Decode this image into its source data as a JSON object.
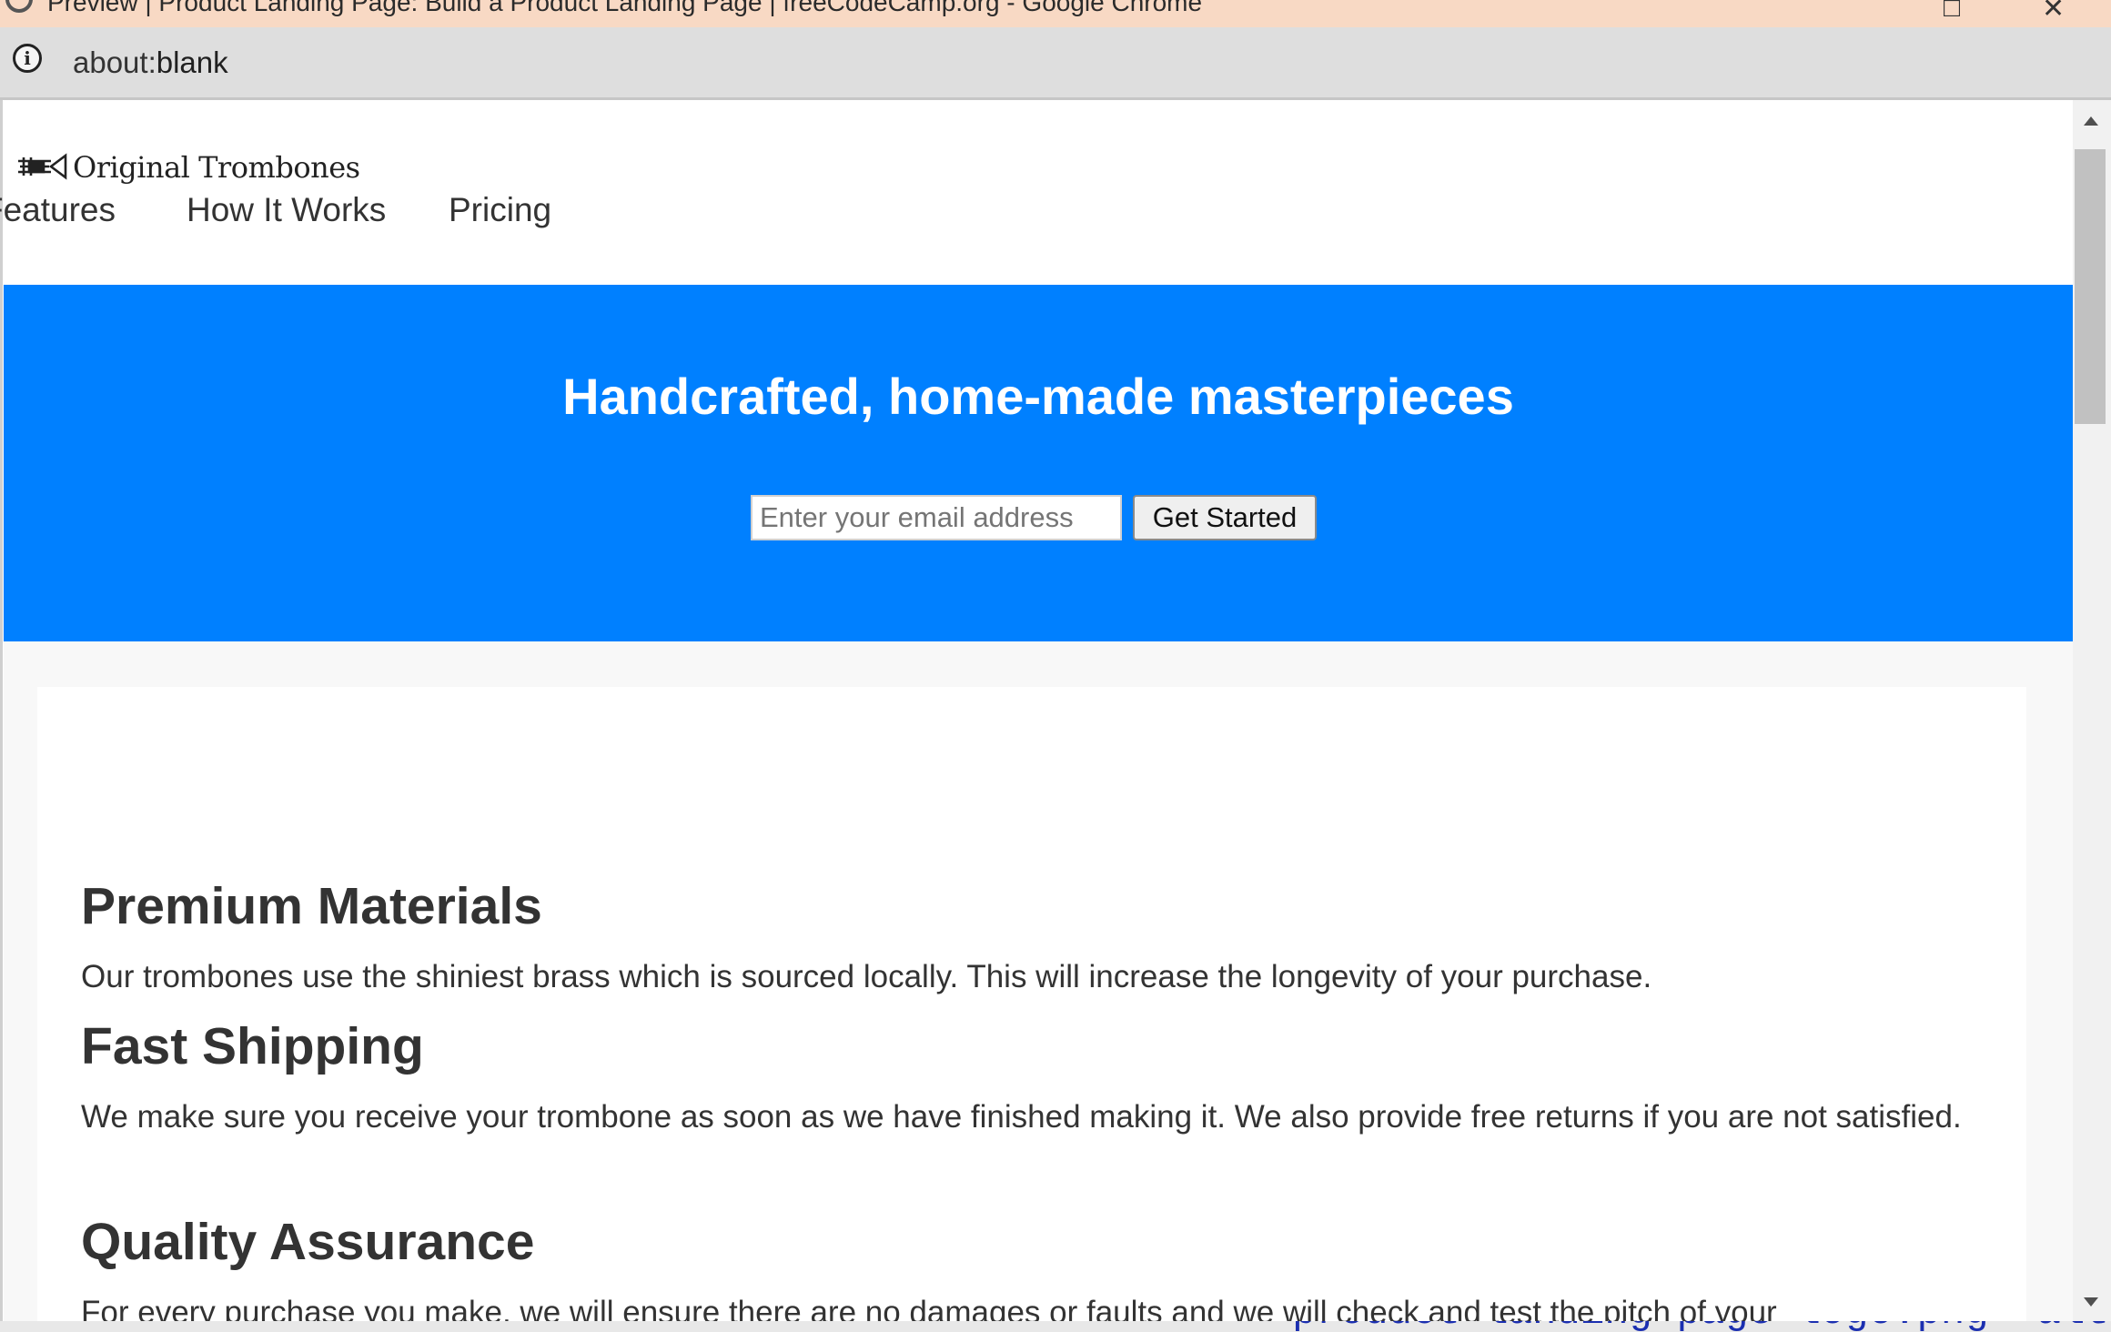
{
  "window": {
    "title": "Preview | Product Landing Page: Build a Product Landing Page | freeCodeCamp.org - Google Chrome",
    "maximize_glyph": "□",
    "close_glyph": "✕"
  },
  "address_bar": {
    "scheme": "about:",
    "host": "blank",
    "info_glyph": "i",
    "info_icon": "info-circle-icon"
  },
  "header": {
    "logo_icon": "trombone-icon",
    "brand": "Original Trombones",
    "nav": [
      {
        "label": "Features"
      },
      {
        "label": "How It Works"
      },
      {
        "label": "Pricing"
      }
    ]
  },
  "hero": {
    "heading": "Handcrafted, home-made masterpieces",
    "email_placeholder": "Enter your email address",
    "button_label": "Get Started",
    "background": "#0080ff"
  },
  "features": [
    {
      "title": "Premium Materials",
      "description": "Our trombones use the shiniest brass which is sourced locally. This will increase the longevity of your purchase."
    },
    {
      "title": "Fast Shipping",
      "description": "We make sure you receive your trombone as soon as we have finished making it. We also provide free returns if you are not satisfied."
    },
    {
      "title": "Quality Assurance",
      "description": "For every purchase you make, we will ensure there are no damages or faults and we will check and test the pitch of your"
    }
  ],
  "bottom_overlay": {
    "code_text": "product landing page logo.png\" alt"
  },
  "scrollbar": {
    "position_fraction": 0.0
  }
}
